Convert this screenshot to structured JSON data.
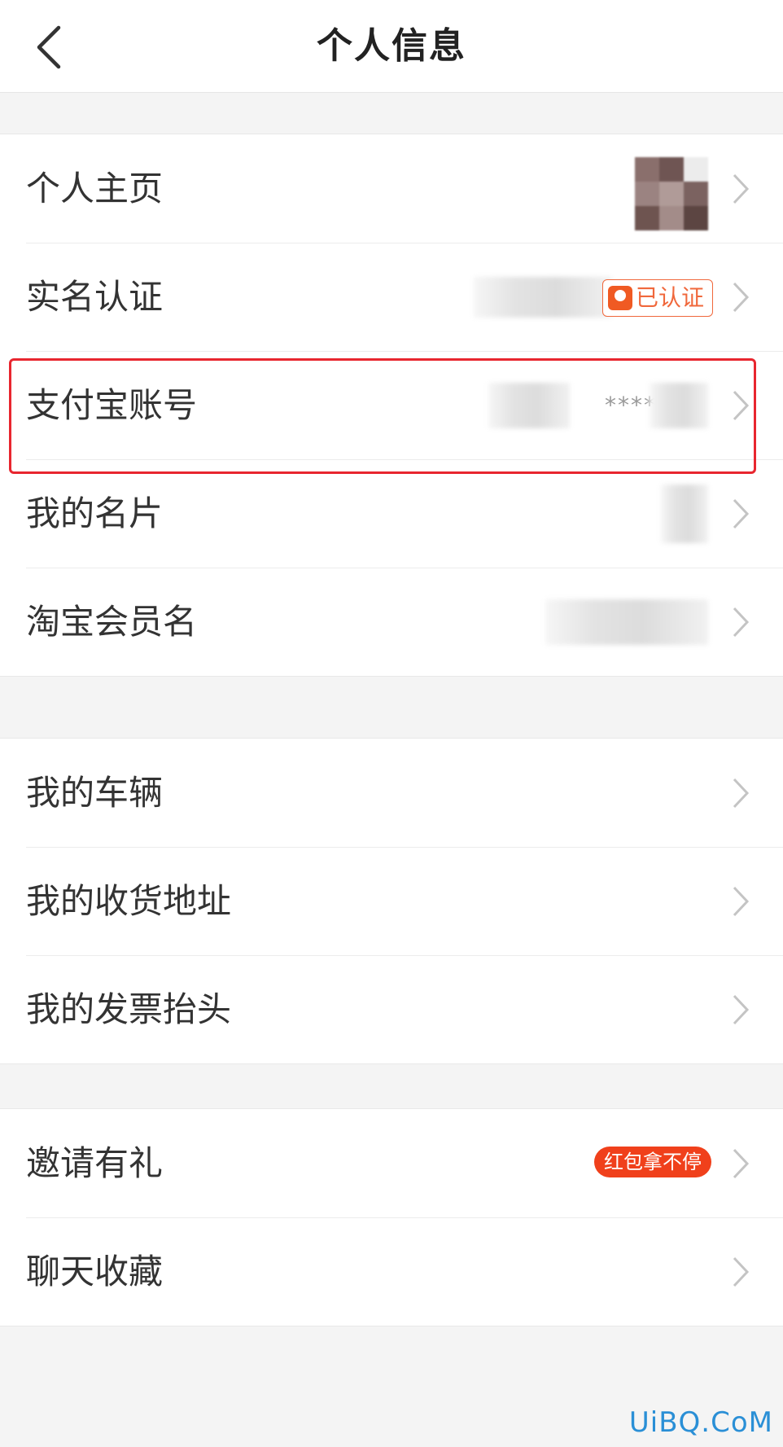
{
  "header": {
    "title": "个人信息"
  },
  "groups": [
    {
      "rows": [
        {
          "label": "个人主页"
        },
        {
          "label": "实名认证",
          "badge": "已认证"
        },
        {
          "label": "支付宝账号",
          "masked": "****"
        },
        {
          "label": "我的名片"
        },
        {
          "label": "淘宝会员名"
        }
      ]
    },
    {
      "rows": [
        {
          "label": "我的车辆"
        },
        {
          "label": "我的收货地址"
        },
        {
          "label": "我的发票抬头"
        }
      ]
    },
    {
      "rows": [
        {
          "label": "邀请有礼",
          "badge": "红包拿不停"
        },
        {
          "label": "聊天收藏"
        }
      ]
    }
  ],
  "watermark": "UiBQ.CoM",
  "colors": {
    "accent": "#f0683c",
    "highlight": "#e8262f",
    "red_badge": "#f0401b"
  },
  "icons": {
    "back": "chevron-left-icon",
    "row_arrow": "chevron-right-icon"
  }
}
